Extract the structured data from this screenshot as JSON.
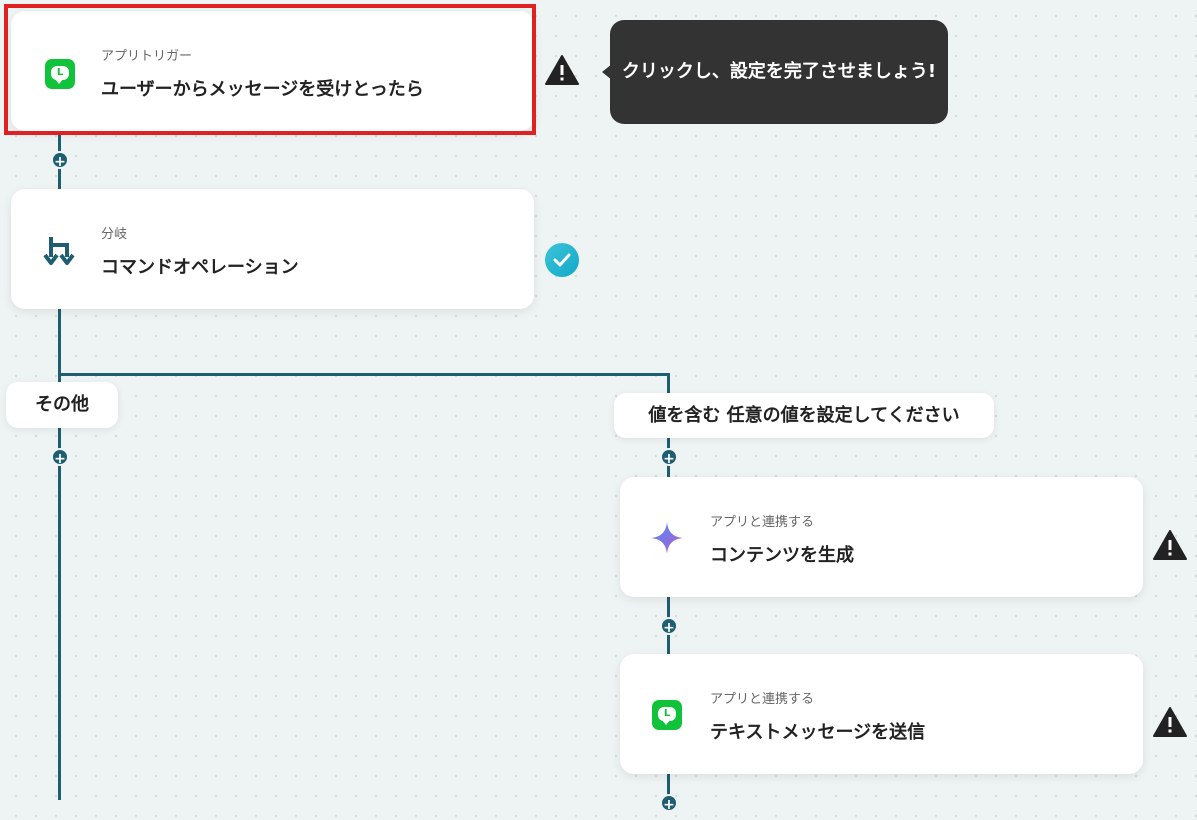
{
  "trigger_card": {
    "category": "アプリトリガー",
    "title": "ユーザーからメッセージを受けとったら",
    "icon": "line-app-icon"
  },
  "tooltip": {
    "text": "クリックし、設定を完了させましょう!"
  },
  "branch_card": {
    "category": "分岐",
    "title": "コマンドオペレーション",
    "icon": "branch-icon"
  },
  "branches": {
    "other_label": "その他",
    "condition_label": "値を含む 任意の値を設定してください"
  },
  "generate_card": {
    "category": "アプリと連携する",
    "title": "コンテンツを生成",
    "icon": "sparkle-icon"
  },
  "send_card": {
    "category": "アプリと連携する",
    "title": "テキストメッセージを送信",
    "icon": "line-app-icon"
  },
  "colors": {
    "connector": "#1e5e70",
    "line_green": "#10c33a",
    "selected_border": "#e02121",
    "check": "#12a8c8",
    "tooltip_bg": "#333333"
  }
}
